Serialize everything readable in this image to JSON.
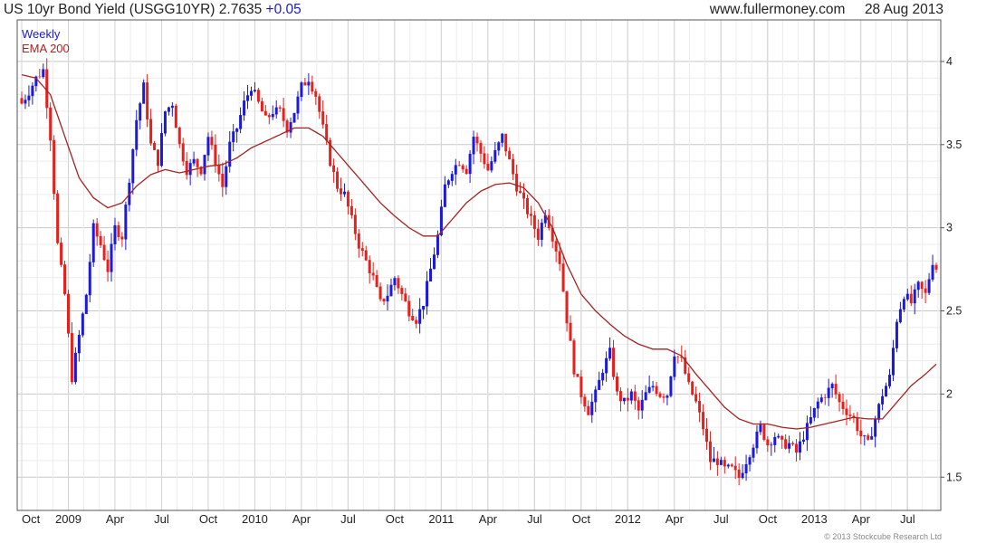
{
  "header": {
    "title": "US 10yr Bond Yield (USGG10YR)",
    "last_value": "2.7635",
    "change": "+0.05",
    "website": "www.fullermoney.com",
    "date": "28 Aug 2013"
  },
  "copyright": "© 2013 Stockcube Research Ltd",
  "colors": {
    "up": "#1a1ad8",
    "down": "#e8201c",
    "ema": "#a52222",
    "grid": "#dcdcdc",
    "axis": "#555555"
  },
  "chart_data": {
    "type": "line",
    "chart_style": "weekly OHLC bars with moving average overlay",
    "period_label": "Weekly",
    "ylim": [
      1.3,
      4.25
    ],
    "y_ticks": [
      1.5,
      2,
      2.5,
      3,
      3.5,
      4
    ],
    "y_tick_labels": [
      "1.5",
      "2",
      "2.5",
      "3",
      "3.5",
      "4"
    ],
    "x_tick_labels": [
      "Oct",
      "2009",
      "Apr",
      "Jul",
      "Oct",
      "2010",
      "Apr",
      "Jul",
      "Oct",
      "2011",
      "Apr",
      "Jul",
      "Oct",
      "2012",
      "Apr",
      "Jul",
      "Oct",
      "2013",
      "Apr",
      "Jul"
    ],
    "x_tick_pos": [
      0,
      13,
      26,
      39,
      52,
      65,
      78,
      91,
      104,
      117,
      130,
      143,
      156,
      169,
      182,
      195,
      208,
      221,
      234,
      247
    ],
    "grid": true,
    "legend_placement": "top-left",
    "series": [
      {
        "name": "Weekly",
        "close_anchors": [
          [
            0,
            3.75
          ],
          [
            2,
            3.82
          ],
          [
            4,
            3.9
          ],
          [
            6,
            3.95
          ],
          [
            8,
            3.55
          ],
          [
            10,
            2.9
          ],
          [
            12,
            2.6
          ],
          [
            14,
            2.1
          ],
          [
            16,
            2.35
          ],
          [
            18,
            2.6
          ],
          [
            20,
            3.0
          ],
          [
            22,
            2.9
          ],
          [
            24,
            2.75
          ],
          [
            26,
            3.0
          ],
          [
            28,
            2.95
          ],
          [
            30,
            3.3
          ],
          [
            32,
            3.65
          ],
          [
            34,
            3.85
          ],
          [
            36,
            3.5
          ],
          [
            38,
            3.4
          ],
          [
            40,
            3.7
          ],
          [
            42,
            3.75
          ],
          [
            44,
            3.5
          ],
          [
            46,
            3.35
          ],
          [
            48,
            3.4
          ],
          [
            50,
            3.35
          ],
          [
            52,
            3.55
          ],
          [
            54,
            3.4
          ],
          [
            56,
            3.25
          ],
          [
            58,
            3.5
          ],
          [
            60,
            3.6
          ],
          [
            62,
            3.75
          ],
          [
            64,
            3.85
          ],
          [
            66,
            3.75
          ],
          [
            68,
            3.65
          ],
          [
            70,
            3.7
          ],
          [
            72,
            3.7
          ],
          [
            74,
            3.6
          ],
          [
            76,
            3.7
          ],
          [
            78,
            3.85
          ],
          [
            80,
            3.9
          ],
          [
            82,
            3.8
          ],
          [
            84,
            3.6
          ],
          [
            86,
            3.4
          ],
          [
            88,
            3.25
          ],
          [
            90,
            3.2
          ],
          [
            92,
            3.05
          ],
          [
            94,
            2.9
          ],
          [
            96,
            2.8
          ],
          [
            98,
            2.7
          ],
          [
            100,
            2.55
          ],
          [
            102,
            2.6
          ],
          [
            104,
            2.7
          ],
          [
            106,
            2.6
          ],
          [
            108,
            2.5
          ],
          [
            110,
            2.45
          ],
          [
            112,
            2.55
          ],
          [
            114,
            2.75
          ],
          [
            116,
            2.95
          ],
          [
            118,
            3.25
          ],
          [
            120,
            3.35
          ],
          [
            122,
            3.4
          ],
          [
            124,
            3.35
          ],
          [
            126,
            3.55
          ],
          [
            128,
            3.45
          ],
          [
            130,
            3.35
          ],
          [
            132,
            3.45
          ],
          [
            134,
            3.55
          ],
          [
            136,
            3.4
          ],
          [
            138,
            3.25
          ],
          [
            140,
            3.15
          ],
          [
            142,
            3.05
          ],
          [
            144,
            2.95
          ],
          [
            146,
            3.1
          ],
          [
            148,
            2.95
          ],
          [
            150,
            2.8
          ],
          [
            152,
            2.45
          ],
          [
            154,
            2.15
          ],
          [
            156,
            2.0
          ],
          [
            158,
            1.9
          ],
          [
            160,
            2.0
          ],
          [
            162,
            2.15
          ],
          [
            164,
            2.25
          ],
          [
            166,
            2.0
          ],
          [
            168,
            1.95
          ],
          [
            170,
            2.0
          ],
          [
            172,
            1.9
          ],
          [
            174,
            2.0
          ],
          [
            176,
            2.05
          ],
          [
            178,
            2.0
          ],
          [
            180,
            2.0
          ],
          [
            182,
            2.25
          ],
          [
            184,
            2.2
          ],
          [
            186,
            2.05
          ],
          [
            188,
            1.95
          ],
          [
            190,
            1.8
          ],
          [
            192,
            1.6
          ],
          [
            194,
            1.6
          ],
          [
            196,
            1.55
          ],
          [
            198,
            1.55
          ],
          [
            200,
            1.5
          ],
          [
            202,
            1.6
          ],
          [
            204,
            1.7
          ],
          [
            206,
            1.8
          ],
          [
            208,
            1.7
          ],
          [
            210,
            1.75
          ],
          [
            212,
            1.7
          ],
          [
            214,
            1.7
          ],
          [
            216,
            1.65
          ],
          [
            218,
            1.75
          ],
          [
            220,
            1.85
          ],
          [
            222,
            1.95
          ],
          [
            224,
            2.0
          ],
          [
            226,
            2.05
          ],
          [
            228,
            1.95
          ],
          [
            230,
            1.9
          ],
          [
            232,
            1.85
          ],
          [
            234,
            1.75
          ],
          [
            236,
            1.7
          ],
          [
            238,
            1.85
          ],
          [
            240,
            2.0
          ],
          [
            242,
            2.1
          ],
          [
            244,
            2.45
          ],
          [
            246,
            2.6
          ],
          [
            248,
            2.55
          ],
          [
            250,
            2.65
          ],
          [
            252,
            2.6
          ],
          [
            254,
            2.8
          ],
          [
            255,
            2.76
          ]
        ],
        "ema_anchors": [
          [
            0,
            3.92
          ],
          [
            4,
            3.9
          ],
          [
            8,
            3.8
          ],
          [
            12,
            3.55
          ],
          [
            16,
            3.3
          ],
          [
            20,
            3.18
          ],
          [
            24,
            3.12
          ],
          [
            28,
            3.15
          ],
          [
            32,
            3.25
          ],
          [
            36,
            3.32
          ],
          [
            40,
            3.35
          ],
          [
            44,
            3.33
          ],
          [
            48,
            3.35
          ],
          [
            52,
            3.37
          ],
          [
            56,
            3.38
          ],
          [
            60,
            3.42
          ],
          [
            64,
            3.48
          ],
          [
            68,
            3.52
          ],
          [
            72,
            3.56
          ],
          [
            76,
            3.6
          ],
          [
            80,
            3.6
          ],
          [
            84,
            3.55
          ],
          [
            88,
            3.45
          ],
          [
            92,
            3.35
          ],
          [
            96,
            3.25
          ],
          [
            100,
            3.15
          ],
          [
            104,
            3.07
          ],
          [
            108,
            3.0
          ],
          [
            112,
            2.95
          ],
          [
            116,
            2.95
          ],
          [
            120,
            3.05
          ],
          [
            124,
            3.15
          ],
          [
            128,
            3.22
          ],
          [
            132,
            3.26
          ],
          [
            136,
            3.27
          ],
          [
            140,
            3.24
          ],
          [
            144,
            3.15
          ],
          [
            148,
            3.0
          ],
          [
            152,
            2.78
          ],
          [
            156,
            2.6
          ],
          [
            160,
            2.5
          ],
          [
            164,
            2.42
          ],
          [
            168,
            2.35
          ],
          [
            172,
            2.3
          ],
          [
            176,
            2.27
          ],
          [
            180,
            2.27
          ],
          [
            184,
            2.23
          ],
          [
            188,
            2.12
          ],
          [
            192,
            2.02
          ],
          [
            196,
            1.92
          ],
          [
            200,
            1.85
          ],
          [
            204,
            1.82
          ],
          [
            208,
            1.82
          ],
          [
            212,
            1.8
          ],
          [
            216,
            1.79
          ],
          [
            220,
            1.8
          ],
          [
            224,
            1.82
          ],
          [
            228,
            1.84
          ],
          [
            232,
            1.86
          ],
          [
            236,
            1.85
          ],
          [
            240,
            1.85
          ],
          [
            244,
            1.95
          ],
          [
            248,
            2.05
          ],
          [
            252,
            2.12
          ],
          [
            255,
            2.18
          ]
        ]
      },
      {
        "name": "EMA 200"
      }
    ]
  }
}
